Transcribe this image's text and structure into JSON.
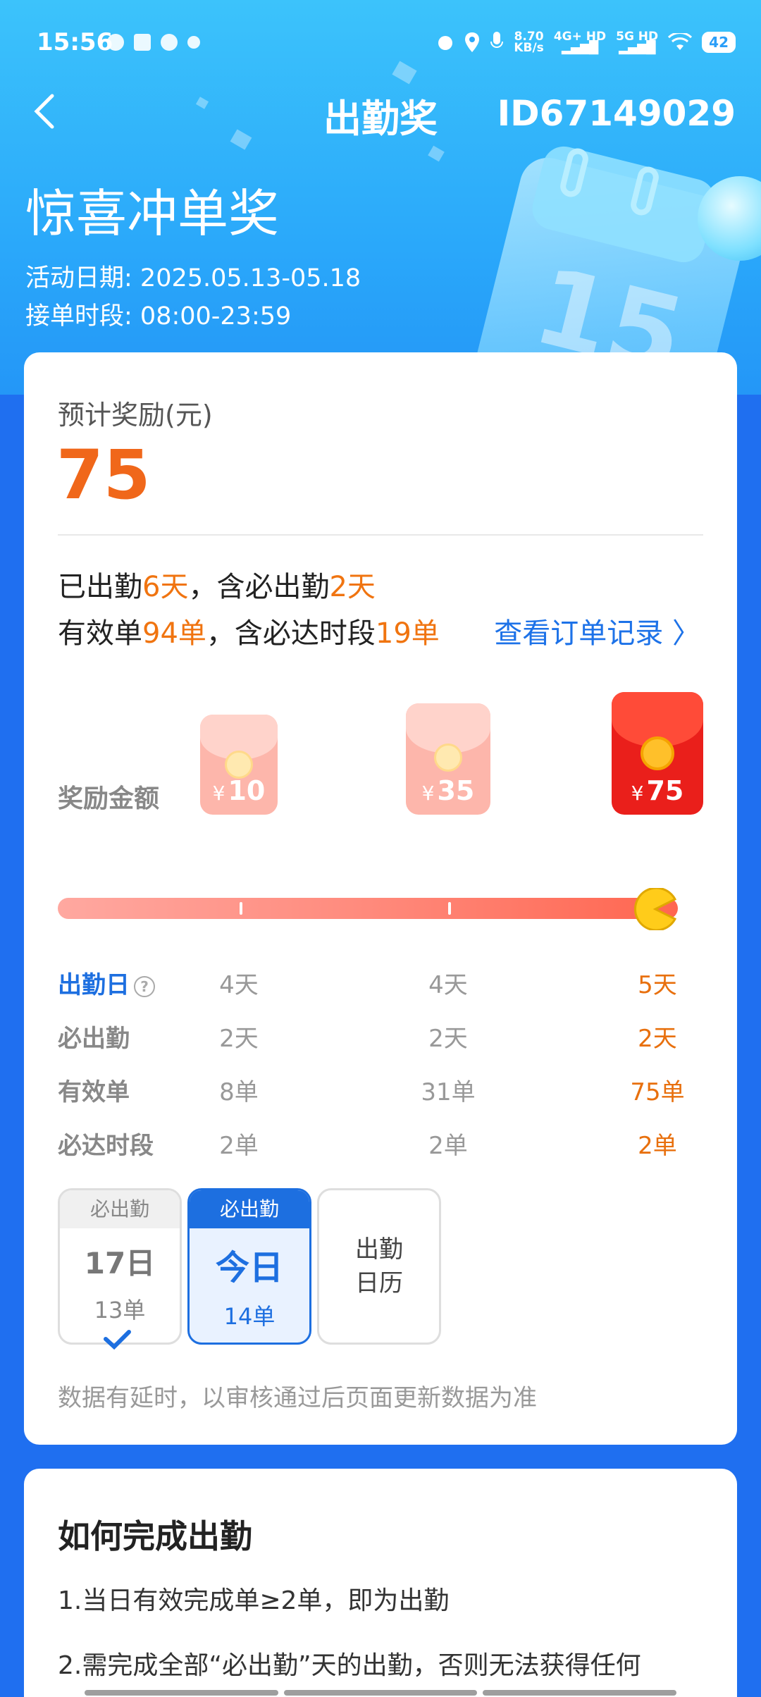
{
  "status_bar": {
    "time": "15:56",
    "net_speed_value": "8.70",
    "net_speed_unit": "KB/s",
    "signal1": "4G+ HD",
    "signal2": "5G HD",
    "battery": "42"
  },
  "header": {
    "title": "出勤奖",
    "user_id": "ID67149029"
  },
  "hero": {
    "campaign_title": "惊喜冲单奖",
    "activity_date_label": "活动日期: ",
    "activity_date": "2025.05.13-05.18",
    "order_time_label": "接单时段: ",
    "order_time": "08:00-23:59",
    "calendar_number": "15"
  },
  "summary": {
    "estimated_label": "预计奖励(元)",
    "estimated_value": "75",
    "line1": {
      "p1": "已出勤",
      "v1": "6天",
      "p2": "，含必出勤",
      "v2": "2天"
    },
    "line2": {
      "p1": "有效单",
      "v1": "94单",
      "p2": "，含必达时段",
      "v2": "19单"
    },
    "order_record_link": "查看订单记录 〉"
  },
  "rewards": {
    "label": "奖励金额",
    "currency": "¥",
    "tiers": [
      "10",
      "35",
      "75"
    ],
    "progress": 1.0
  },
  "table": {
    "rows": [
      {
        "label": "出勤日",
        "values": [
          "4天",
          "4天",
          "5天"
        ]
      },
      {
        "label": "必出勤",
        "values": [
          "2天",
          "2天",
          "2天"
        ]
      },
      {
        "label": "有效单",
        "values": [
          "8单",
          "31单",
          "75单"
        ]
      },
      {
        "label": "必达时段",
        "values": [
          "2单",
          "2单",
          "2单"
        ]
      }
    ]
  },
  "days": [
    {
      "tag": "必出勤",
      "day": "17日",
      "orders": "13单"
    },
    {
      "tag": "必出勤",
      "day": "今日",
      "orders": "14单"
    }
  ],
  "calendar_button": {
    "line1": "出勤",
    "line2": "日历"
  },
  "note": "数据有延时，以审核通过后页面更新数据为准",
  "how_to": {
    "title": "如何完成出勤",
    "rule1": "1.当日有效完成单≥2单，即为出勤",
    "rule2": "2.需完成全部“必出勤”天的出勤，否则无法获得任何"
  },
  "colors": {
    "accent_blue": "#1d6fe0",
    "accent_orange": "#f0671a",
    "envelope_red": "#ea1f1b"
  }
}
